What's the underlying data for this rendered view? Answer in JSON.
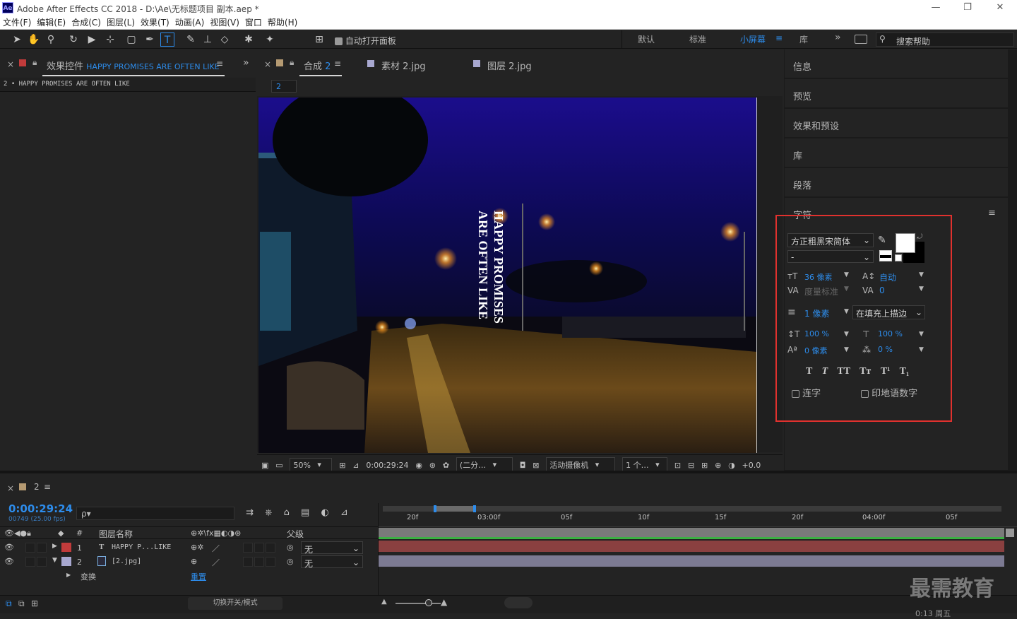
{
  "window": {
    "app_logo": "Ae",
    "title": "Adobe After Effects CC 2018 - D:\\Ae\\无标题项目 副本.aep *",
    "minimize": "—",
    "maximize": "❐",
    "close": "✕"
  },
  "menu": [
    "文件(F)",
    "编辑(E)",
    "合成(C)",
    "图层(L)",
    "效果(T)",
    "动画(A)",
    "视图(V)",
    "窗口",
    "帮助(H)"
  ],
  "toolbar": {
    "auto_open": "自动打开面板",
    "workspaces": [
      "默认",
      "标准",
      "小屏幕",
      "库"
    ],
    "active_workspace": "小屏幕",
    "more": "»",
    "search_placeholder": "搜索帮助"
  },
  "effects_panel": {
    "close": "×",
    "title": "效果控件",
    "layer_name": "HAPPY PROMISES ARE OFTEN LIKE",
    "menu": "≡",
    "expand": "»",
    "breadcrumb": "2 • HAPPY PROMISES ARE OFTEN LIKE"
  },
  "comp_panel": {
    "close": "×",
    "tabs": [
      {
        "label": "合成",
        "suffix": "2",
        "active": true
      },
      {
        "label": "素材 2.jpg",
        "active": false
      },
      {
        "label": "图层 2.jpg",
        "active": false
      }
    ],
    "menu": "≡",
    "comp_tag": "2"
  },
  "viewer": {
    "overlay_line1": "HAPPY PROMISES",
    "overlay_line2": "ARE OFTEN LIKE",
    "zoom": "50%",
    "timecode": "0:00:29:24",
    "resolution": "(二分…",
    "camera": "活动摄像机",
    "views": "1 个…",
    "exposure": "+0.0"
  },
  "right_panel": {
    "items": [
      "信息",
      "预览",
      "效果和预设",
      "库",
      "段落",
      "字符"
    ],
    "char_menu": "≡"
  },
  "character": {
    "font": "方正粗黑宋简体",
    "style": "-",
    "size": "36 像素",
    "leading": "自动",
    "kerning": "度量标准",
    "tracking": "0",
    "stroke_width": "1 像素",
    "stroke_type": "在填充上描边",
    "vscale": "100 %",
    "hscale": "100 %",
    "baseline": "0 像素",
    "tsume": "0 %",
    "style_buttons": [
      "T",
      "T",
      "TT",
      "Tт",
      "T¹",
      "T₁"
    ],
    "ligatures": "连字",
    "hindi_digits": "印地语数字",
    "fill_color": "#ffffff",
    "stroke_color": "#000000"
  },
  "timeline": {
    "close": "×",
    "comp_name": "2",
    "menu": "≡",
    "timecode": "0:00:29:24",
    "frames": "00749 (25.00 fps)",
    "search_placeholder": "ρ▾",
    "col_num": "#",
    "col_name": "图层名称",
    "col_parent": "父级",
    "ruler": [
      "20f",
      "03:00f",
      "05f",
      "10f",
      "15f",
      "20f",
      "04:00f",
      "05f"
    ],
    "layers": [
      {
        "num": "1",
        "type": "T",
        "name": "HAPPY P...LIKE",
        "parent": "无",
        "color": "#c13b3b"
      },
      {
        "num": "2",
        "type": "img",
        "name": "[2.jpg]",
        "parent": "无",
        "color": "#a8a8d0"
      }
    ],
    "transform_label": "变换",
    "transform_reset": "重置",
    "toggle_label": "切换开关/模式"
  },
  "watermark": "最需教育",
  "status_partial": "0:13 周五"
}
